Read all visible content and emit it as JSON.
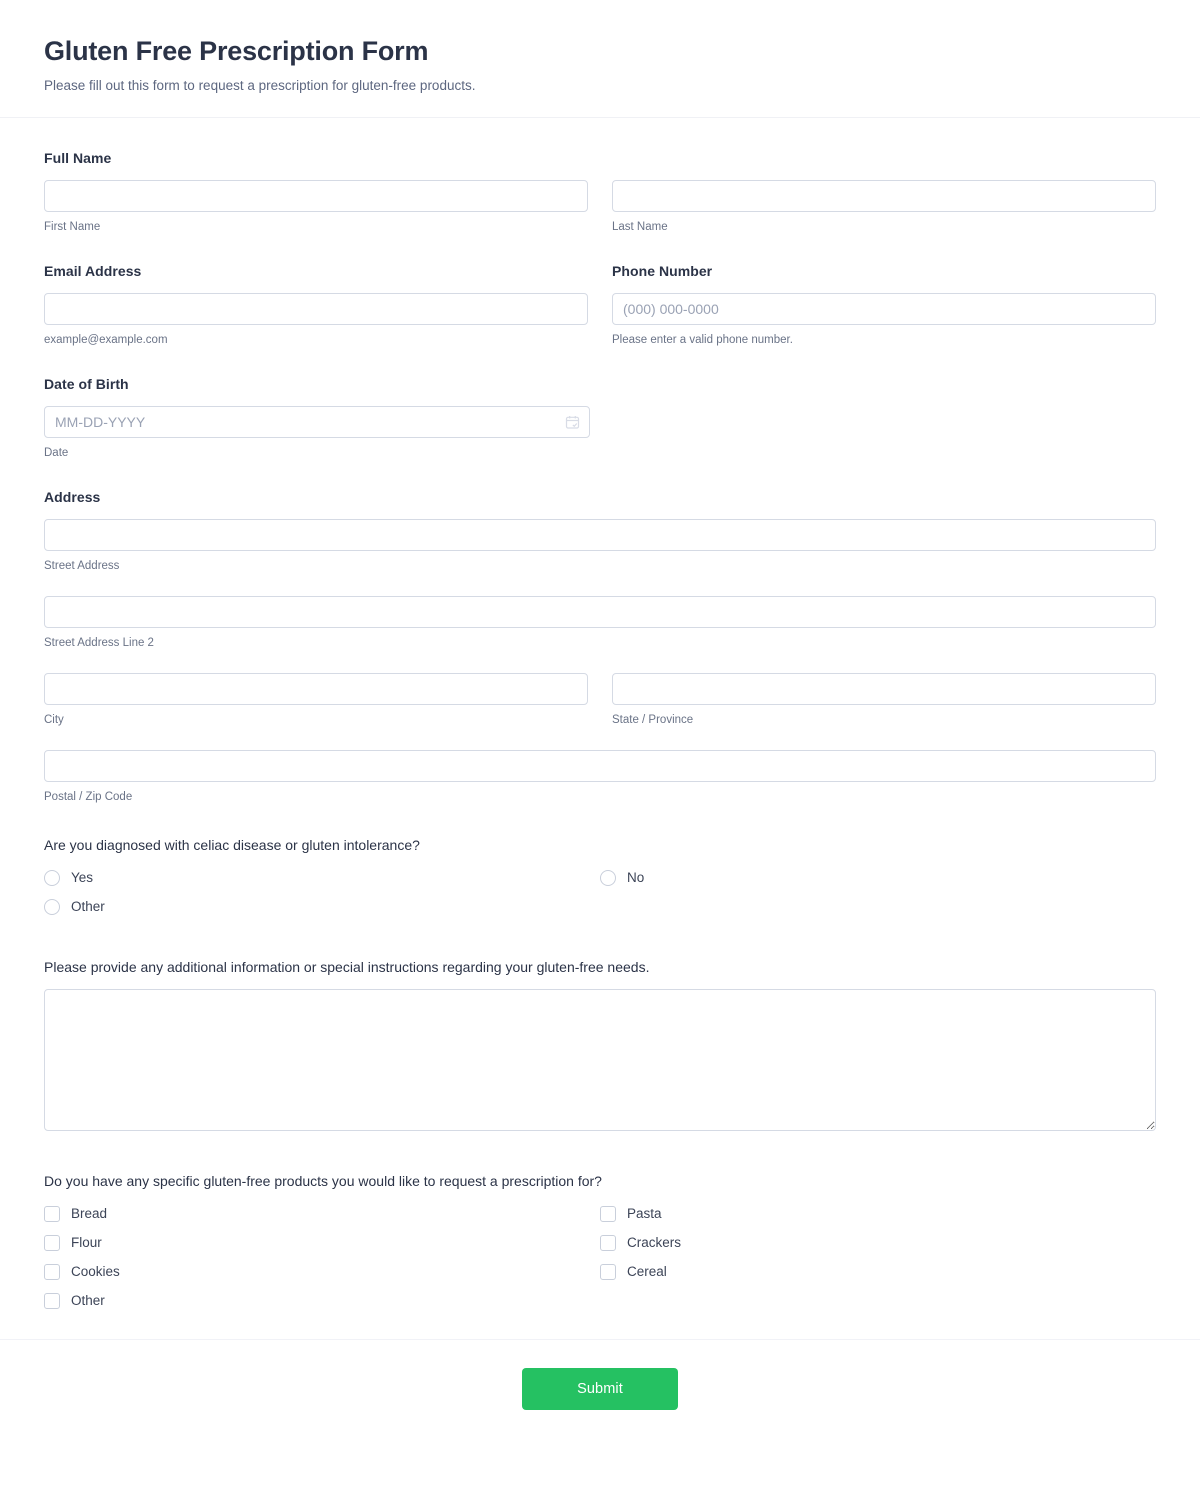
{
  "header": {
    "title": "Gluten Free Prescription Form",
    "subtitle": "Please fill out this form to request a prescription for gluten-free products."
  },
  "fields": {
    "full_name": {
      "label": "Full Name",
      "first": {
        "value": "",
        "placeholder": "",
        "sublabel": "First Name"
      },
      "last": {
        "value": "",
        "placeholder": "",
        "sublabel": "Last Name"
      }
    },
    "email": {
      "label": "Email Address",
      "value": "",
      "placeholder": "",
      "sublabel": "example@example.com"
    },
    "phone": {
      "label": "Phone Number",
      "value": "",
      "placeholder": "(000) 000-0000",
      "sublabel": "Please enter a valid phone number."
    },
    "dob": {
      "label": "Date of Birth",
      "value": "",
      "placeholder": "MM-DD-YYYY",
      "sublabel": "Date",
      "icon": "calendar-icon"
    },
    "address": {
      "label": "Address",
      "street": {
        "value": "",
        "placeholder": "",
        "sublabel": "Street Address"
      },
      "street2": {
        "value": "",
        "placeholder": "",
        "sublabel": "Street Address Line 2"
      },
      "city": {
        "value": "",
        "placeholder": "",
        "sublabel": "City"
      },
      "state": {
        "value": "",
        "placeholder": "",
        "sublabel": "State / Province"
      },
      "postal": {
        "value": "",
        "placeholder": "",
        "sublabel": "Postal / Zip Code"
      }
    },
    "diagnosis": {
      "question": "Are you diagnosed with celiac disease or gluten intolerance?",
      "options_left": [
        "Yes",
        "Other"
      ],
      "options_right": [
        "No"
      ]
    },
    "additional_info": {
      "question": "Please provide any additional information or special instructions regarding your gluten-free needs.",
      "value": "",
      "placeholder": ""
    },
    "products": {
      "question": "Do you have any specific gluten-free products you would like to request a prescription for?",
      "options_left": [
        "Bread",
        "Flour",
        "Cookies",
        "Other"
      ],
      "options_right": [
        "Pasta",
        "Crackers",
        "Cereal"
      ]
    }
  },
  "footer": {
    "submit_label": "Submit",
    "submit_color": "#25c162"
  }
}
